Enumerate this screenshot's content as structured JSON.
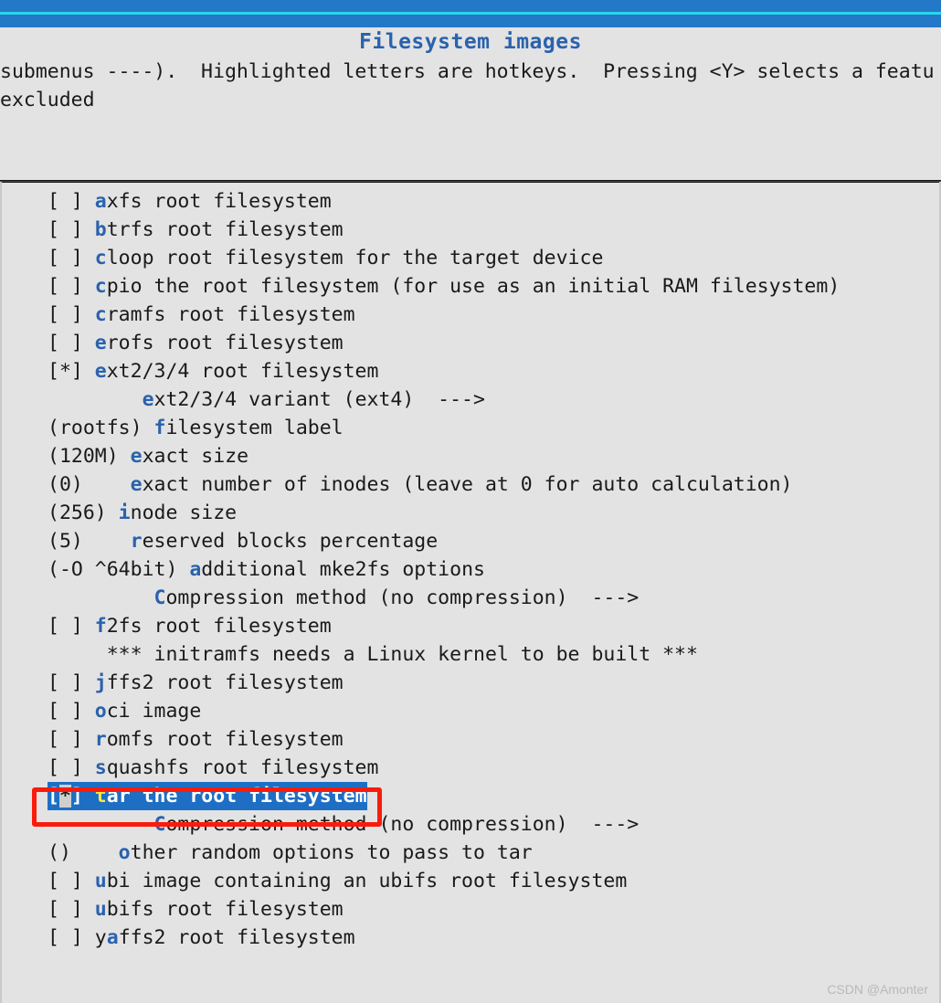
{
  "window": {
    "title": "Filesystem images",
    "help_lines": [
      "submenus ----).  Highlighted letters are hotkeys.  Pressing <Y> selects a featu",
      "excluded"
    ]
  },
  "colors": {
    "topbar_blue": "#2478c8",
    "cyan_line": "#2ad6e8",
    "background": "#e3e3e3",
    "hotkey_blue": "#2a62ad",
    "selection_blue": "#1e6fc4",
    "selection_text": "#ffffff",
    "selection_hotkey_yellow": "#ffe84a",
    "cursor_block": "#cfcfcf",
    "annotation_red": "#fb1b0c",
    "text": "#1a1a1a"
  },
  "list": {
    "items": [
      {
        "prefix": "[ ] ",
        "hot": "a",
        "rest": "xfs root filesystem",
        "selected": false
      },
      {
        "prefix": "[ ] ",
        "hot": "b",
        "rest": "trfs root filesystem",
        "selected": false
      },
      {
        "prefix": "[ ] ",
        "hot": "c",
        "rest": "loop root filesystem for the target device",
        "selected": false
      },
      {
        "prefix": "[ ] ",
        "hot": "c",
        "rest": "pio the root filesystem (for use as an initial RAM filesystem)",
        "selected": false
      },
      {
        "prefix": "[ ] ",
        "hot": "c",
        "rest": "ramfs root filesystem",
        "selected": false
      },
      {
        "prefix": "[ ] ",
        "hot": "e",
        "rest": "rofs root filesystem",
        "selected": false
      },
      {
        "prefix": "[*] ",
        "hot": "e",
        "rest": "xt2/3/4 root filesystem",
        "selected": false
      },
      {
        "prefix": "        ",
        "hot": "e",
        "rest": "xt2/3/4 variant (ext4)  --->",
        "selected": false
      },
      {
        "prefix": "(rootfs) ",
        "hot": "f",
        "rest": "ilesystem label",
        "selected": false
      },
      {
        "prefix": "(120M) ",
        "hot": "e",
        "rest": "xact size",
        "selected": false
      },
      {
        "prefix": "(0)    ",
        "hot": "e",
        "rest": "xact number of inodes (leave at 0 for auto calculation)",
        "selected": false
      },
      {
        "prefix": "(256) ",
        "hot": "i",
        "rest": "node size",
        "selected": false
      },
      {
        "prefix": "(5)    ",
        "hot": "r",
        "rest": "eserved blocks percentage",
        "selected": false
      },
      {
        "prefix": "(-O ^64bit) ",
        "hot": "a",
        "rest": "dditional mke2fs options",
        "selected": false
      },
      {
        "prefix": "         ",
        "hot": "C",
        "rest": "ompression method (no compression)  --->",
        "selected": false
      },
      {
        "prefix": "[ ] ",
        "hot": "f",
        "rest": "2fs root filesystem",
        "selected": false
      },
      {
        "prefix": "     ",
        "hot": "",
        "rest": "*** initramfs needs a Linux kernel to be built ***",
        "selected": false
      },
      {
        "prefix": "[ ] ",
        "hot": "j",
        "rest": "ffs2 root filesystem",
        "selected": false
      },
      {
        "prefix": "[ ] ",
        "hot": "o",
        "rest": "ci image",
        "selected": false
      },
      {
        "prefix": "[ ] ",
        "hot": "r",
        "rest": "omfs root filesystem",
        "selected": false
      },
      {
        "prefix": "[ ] ",
        "hot": "s",
        "rest": "quashfs root filesystem",
        "selected": false
      },
      {
        "prefix": "[*] ",
        "hot": "t",
        "rest": "ar the root filesystem",
        "selected": true,
        "sel_open": "[",
        "sel_cursor": "*",
        "sel_close": "] ",
        "sel_hot": "t",
        "sel_rest": "ar the root filesystem"
      },
      {
        "prefix": "         ",
        "hot": "C",
        "rest": "ompression method (no compression)  --->",
        "selected": false
      },
      {
        "prefix": "()    ",
        "hot": "o",
        "rest": "ther random options to pass to tar",
        "selected": false
      },
      {
        "prefix": "[ ] ",
        "hot": "u",
        "rest": "bi image containing an ubifs root filesystem",
        "selected": false
      },
      {
        "prefix": "[ ] ",
        "hot": "u",
        "rest": "bifs root filesystem",
        "selected": false
      },
      {
        "prefix": "[ ] y",
        "hot": "a",
        "rest": "ffs2 root filesystem",
        "selected": false
      }
    ]
  },
  "annotation": {
    "type": "red-rectangle-highlight",
    "target": "tar the root filesystem"
  },
  "watermark": {
    "text": "CSDN @Amonter"
  }
}
